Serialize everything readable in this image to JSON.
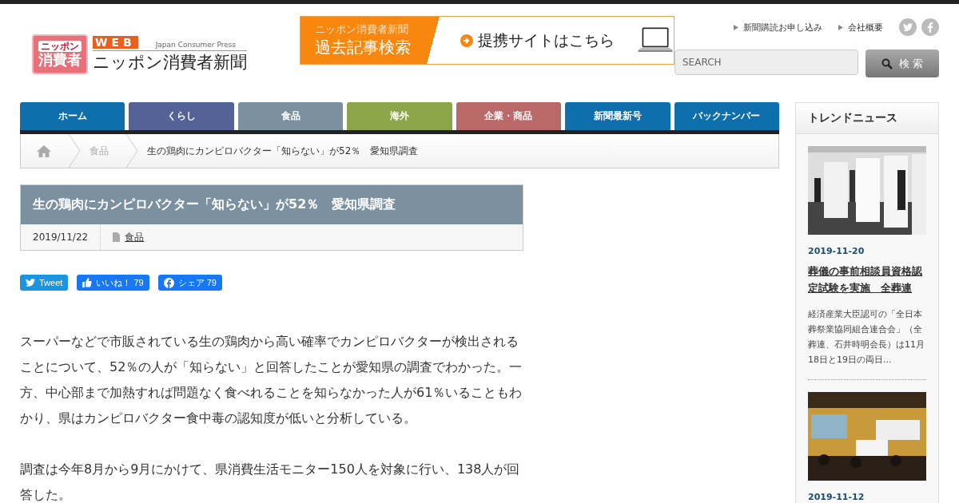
{
  "header": {
    "logo": {
      "badge_top": "ニッポン",
      "badge": "消費者",
      "web": "WEB",
      "tagline": "Japan Consumer Press",
      "name": "ニッポン消費者新聞"
    },
    "banner": {
      "subtitle": "ニッポン消費者新聞",
      "title": "過去記事検索",
      "link": "提携サイトはこちら"
    },
    "top_links": [
      "新聞購読お申し込み",
      "会社概要"
    ],
    "search": {
      "placeholder": "SEARCH",
      "button": "検 索"
    }
  },
  "nav": [
    {
      "label": "ホーム",
      "color": "#0f6fad"
    },
    {
      "label": "くらし",
      "color": "#546295"
    },
    {
      "label": "食品",
      "color": "#7b919f"
    },
    {
      "label": "海外",
      "color": "#8ca548"
    },
    {
      "label": "企業・商品",
      "color": "#b96968"
    },
    {
      "label": "新聞最新号",
      "color": "#0f6fad"
    },
    {
      "label": "バックナンバー",
      "color": "#0f6fad"
    }
  ],
  "breadcrumb": [
    "食品",
    "生の鶏肉にカンピロバクター「知らない」が52％　愛知県調査"
  ],
  "article": {
    "title": "生の鶏肉にカンピロバクター「知らない」が52％　愛知県調査",
    "date": "2019/11/22",
    "category": "食品",
    "share": [
      {
        "kind": "tweet",
        "label": "Tweet"
      },
      {
        "kind": "like",
        "label": "いいね！ 79"
      },
      {
        "kind": "share",
        "label": "シェア 79"
      }
    ],
    "paragraphs": [
      "スーパーなどで市販されている生の鶏肉から高い確率でカンピロバクターが検出されることについて、52％の人が「知らない」と回答したことが愛知県の調査でわかった。一方、中心部まで加熱すれば問題なく食べれることを知らなかった人が61％いることもわかり、県はカンピロバクター食中毒の認知度が低いと分析している。",
      "調査は今年8月から9月にかけて、県消費生活モニター150人を対象に行い、138人が回答した。"
    ]
  },
  "sidebar": {
    "title": "トレンドニュース",
    "items": [
      {
        "kind": "office",
        "date": "2019-11-20",
        "title": "葬儀の事前相談員資格認定試験を実施　全葬連",
        "excerpt": "経済産業大臣認可の「全日本葬祭業協同組合連合会」（全葬連、石井時明会長）は11月18日と19日の両日..."
      },
      {
        "kind": "stage",
        "date": "2019-11-12"
      }
    ]
  }
}
